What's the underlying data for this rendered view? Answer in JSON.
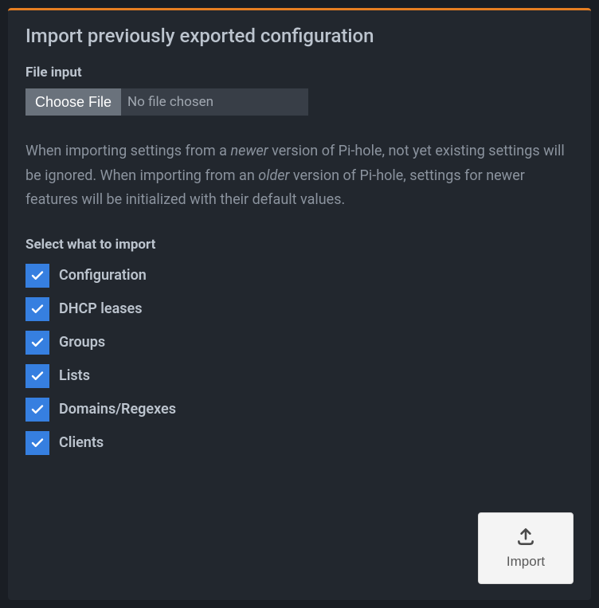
{
  "card": {
    "title": "Import previously exported configuration"
  },
  "fileInput": {
    "label": "File input",
    "buttonLabel": "Choose File",
    "status": "No file chosen"
  },
  "helpText": {
    "part1": "When importing settings from a ",
    "em1": "newer",
    "part2": " version of Pi-hole, not yet existing settings will be ignored. When importing from an ",
    "em2": "older",
    "part3": " version of Pi-hole, settings for newer features will be initialized with their default values."
  },
  "select": {
    "heading": "Select what to import",
    "items": [
      {
        "label": "Configuration",
        "checked": true
      },
      {
        "label": "DHCP leases",
        "checked": true
      },
      {
        "label": "Groups",
        "checked": true
      },
      {
        "label": "Lists",
        "checked": true
      },
      {
        "label": "Domains/Regexes",
        "checked": true
      },
      {
        "label": "Clients",
        "checked": true
      }
    ]
  },
  "importButton": {
    "label": "Import"
  }
}
